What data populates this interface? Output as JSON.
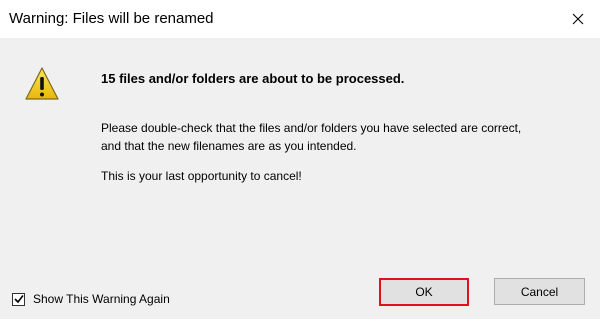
{
  "dialog": {
    "title": "Warning: Files will be renamed",
    "close_icon": "close-icon",
    "warning_icon": "warning-triangle-icon",
    "headline": "15 files and/or folders are about to be processed.",
    "body_line1": "Please double-check that the files and/or folders you have selected are correct,",
    "body_line2": "and that the new filenames are as you intended.",
    "last_chance": "This is your last opportunity to cancel!",
    "show_warning_checkbox": {
      "label": "Show This Warning Again",
      "checked": true
    },
    "ok_label": "OK",
    "cancel_label": "Cancel"
  },
  "colors": {
    "highlight_border": "#e3111c",
    "warning_yellow": "#f5d219",
    "content_bg": "#f0f0f0"
  }
}
